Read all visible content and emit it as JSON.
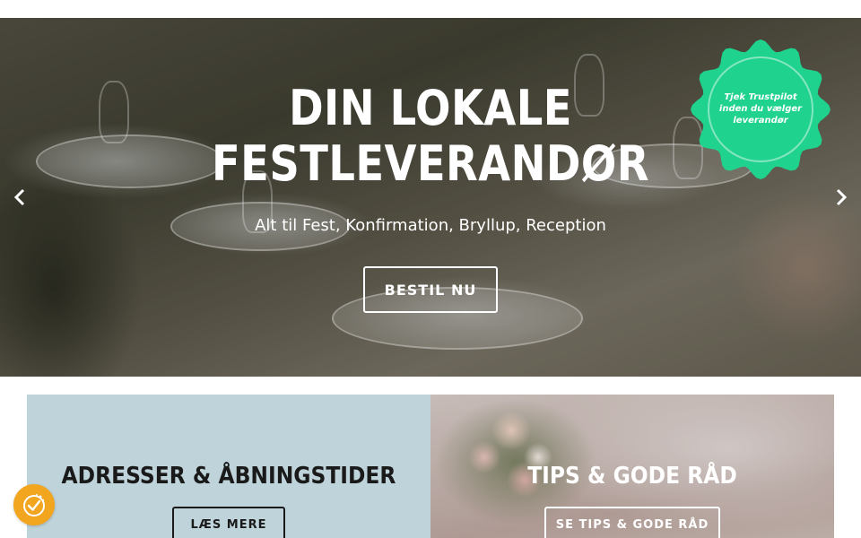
{
  "hero": {
    "title_line1": "DIN LOKALE",
    "title_line2": "FESTLEVERANDØR",
    "subtitle": "Alt til Fest, Konfirmation, Bryllup, Reception",
    "cta_label": "BESTIL NU"
  },
  "badge": {
    "line1": "Tjek Trustpilot",
    "line2": "inden du vælger",
    "line3": "leverandør",
    "color": "#1fd28e"
  },
  "cards": [
    {
      "title": "ADRESSER & ÅBNINGSTIDER",
      "button_label": "LÆS MERE",
      "background": "#bfd3da"
    },
    {
      "title": "TIPS & GODE RÅD",
      "button_label": "SE TIPS & GODE RÅD"
    }
  ],
  "icons": {
    "prev": "chevron-left-icon",
    "next": "chevron-right-icon",
    "cookie": "cookie-consent-icon"
  },
  "colors": {
    "accent_orange": "#f2a51e",
    "badge_green": "#1fd28e"
  }
}
